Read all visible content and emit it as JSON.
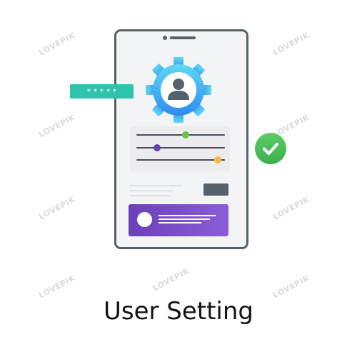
{
  "caption": "User Setting",
  "watermark": "LOVEPIK",
  "password_badge": {
    "mask": "* * * * *"
  },
  "sliders": [
    {
      "level": 0.56,
      "knob_color": "#6cc04a"
    },
    {
      "level": 0.23,
      "knob_color": "#6b40b9"
    },
    {
      "level": 0.92,
      "knob_color": "#f6b93a"
    }
  ],
  "colors": {
    "phone_frame": "#56626b",
    "gear_gradient_top": "#5fd8f4",
    "gear_gradient_bottom": "#2f8bf0",
    "card_gradient_left": "#6b40b9",
    "card_gradient_right": "#8b5dd8",
    "password_badge": "#2fc2ad",
    "check_badge": "#4bbf5a"
  },
  "icons": {
    "gear": "gear-user-icon",
    "check": "check-icon",
    "avatar": "user-avatar-icon"
  }
}
